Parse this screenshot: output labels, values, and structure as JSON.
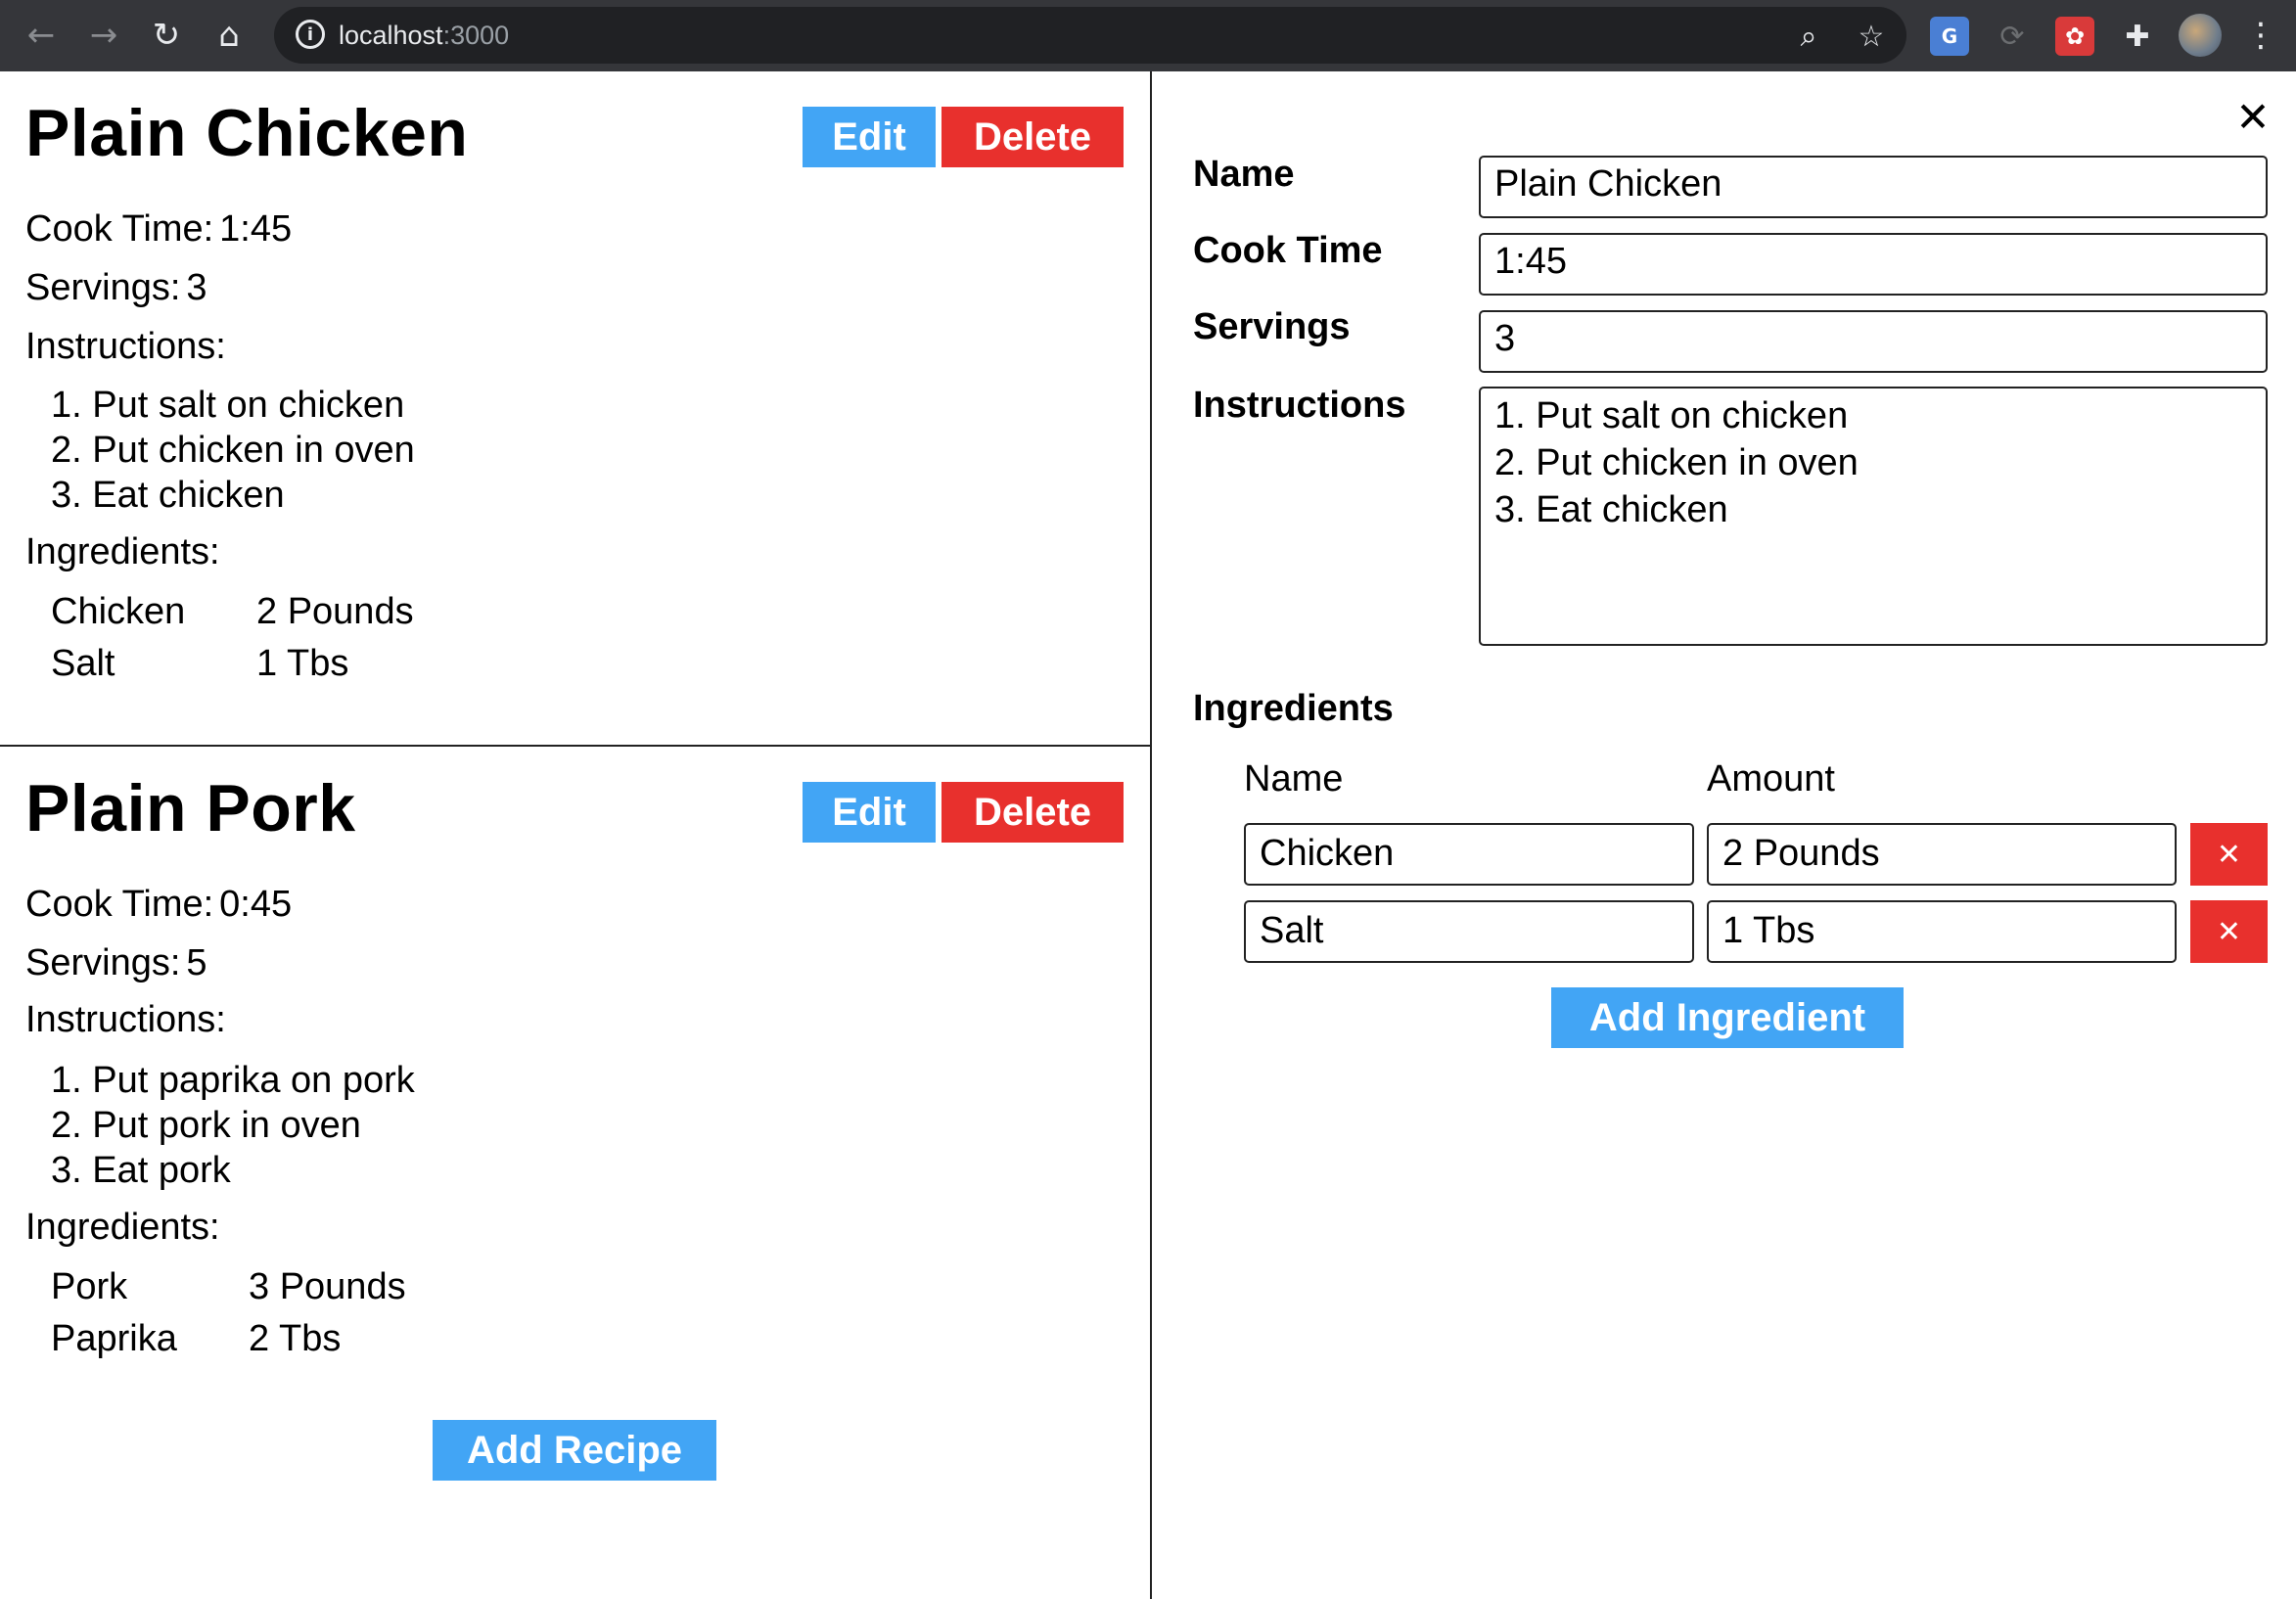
{
  "browser": {
    "url_host": "localhost",
    "url_port": ":3000"
  },
  "recipes": [
    {
      "title": "Plain Chicken",
      "edit_label": "Edit",
      "delete_label": "Delete",
      "cook_time_label": "Cook Time:",
      "cook_time": "1:45",
      "servings_label": "Servings:",
      "servings": "3",
      "instructions_label": "Instructions:",
      "instructions": [
        "1. Put salt on chicken",
        "2. Put chicken in oven",
        "3. Eat chicken"
      ],
      "ingredients_label": "Ingredients:",
      "ingredients": [
        {
          "name": "Chicken",
          "amount": "2 Pounds"
        },
        {
          "name": "Salt",
          "amount": "1 Tbs"
        }
      ]
    },
    {
      "title": "Plain Pork",
      "edit_label": "Edit",
      "delete_label": "Delete",
      "cook_time_label": "Cook Time:",
      "cook_time": "0:45",
      "servings_label": "Servings:",
      "servings": "5",
      "instructions_label": "Instructions:",
      "instructions": [
        "1. Put paprika on pork",
        "2. Put pork in oven",
        "3. Eat pork"
      ],
      "ingredients_label": "Ingredients:",
      "ingredients": [
        {
          "name": "Pork",
          "amount": "3 Pounds"
        },
        {
          "name": "Paprika",
          "amount": "2 Tbs"
        }
      ]
    }
  ],
  "add_recipe_label": "Add Recipe",
  "edit_panel": {
    "close_icon": "close-icon",
    "name_label": "Name",
    "name_value": "Plain Chicken",
    "cook_time_label": "Cook Time",
    "cook_time_value": "1:45",
    "servings_label": "Servings",
    "servings_value": "3",
    "instructions_label": "Instructions",
    "instructions_value": "1. Put salt on chicken\n2. Put chicken in oven\n3. Eat chicken",
    "ingredients_label": "Ingredients",
    "ingredients_name_header": "Name",
    "ingredients_amount_header": "Amount",
    "ingredients": [
      {
        "name": "Chicken",
        "amount": "2 Pounds"
      },
      {
        "name": "Salt",
        "amount": "1 Tbs"
      }
    ],
    "remove_symbol": "✕",
    "add_ingredient_label": "Add Ingredient"
  },
  "colors": {
    "primary": "#42a5f5",
    "danger": "#e8302d",
    "chrome": "#35363a"
  }
}
